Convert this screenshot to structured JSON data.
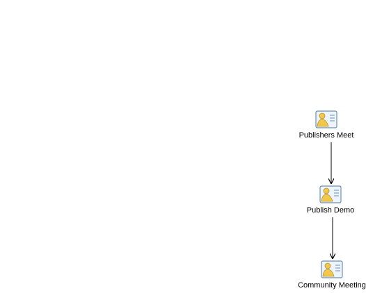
{
  "diagram": {
    "nodes": [
      {
        "label": "Publishers Meet",
        "icon": "contact-card-icon"
      },
      {
        "label": "Publish Demo",
        "icon": "contact-card-icon"
      },
      {
        "label": "Community Meeting",
        "icon": "contact-card-icon"
      }
    ],
    "edges": [
      {
        "from": 0,
        "to": 1
      },
      {
        "from": 1,
        "to": 2
      }
    ]
  },
  "colors": {
    "arrow": "#000000",
    "card_border": "#6a8fb5",
    "card_fill": "#eef4fb",
    "person": "#f2c84b",
    "person_outline": "#b8902a"
  }
}
